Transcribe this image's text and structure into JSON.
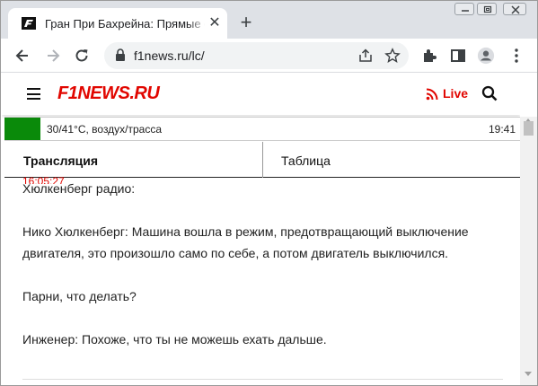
{
  "browser": {
    "tab_title": "Гран При Бахрейна: Прямые он",
    "url": "f1news.ru/lc/"
  },
  "site": {
    "logo_f1": "F1",
    "logo_news": "NEWS.RU",
    "live_label": "Live"
  },
  "weather": {
    "text": "30/41°C, воздух/трасса",
    "time": "19:41",
    "flag_color": "#0a8a0a"
  },
  "tabs": {
    "left": "Трансляция",
    "right": "Таблица"
  },
  "content": {
    "timestamp": "16:05:27",
    "paragraphs": [
      "Хюлкенберг радио:",
      "Нико Хюлкенберг: Машина вошла в режим, предотвращающий выключение двигателя, это произошло само по себе, а потом двигатель выключился.",
      "Парни, что делать?",
      "Инженер: Похоже, что ты не можешь ехать дальше."
    ]
  },
  "colors": {
    "accent": "#e10600"
  }
}
